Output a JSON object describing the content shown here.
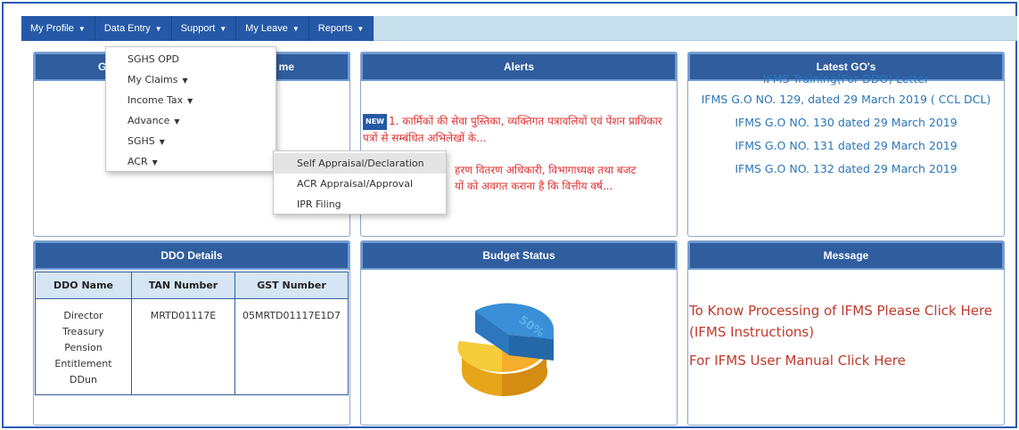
{
  "navbar": {
    "items": [
      {
        "label": "My Profile"
      },
      {
        "label": "Data Entry"
      },
      {
        "label": "Support"
      },
      {
        "label": "My Leave"
      },
      {
        "label": "Reports"
      }
    ]
  },
  "user_panel": {
    "head_left": "Gr",
    "head_right": "me"
  },
  "data_entry_menu": {
    "items": [
      {
        "label": "SGHS OPD"
      },
      {
        "label": "My Claims"
      },
      {
        "label": "Income Tax"
      },
      {
        "label": "Advance"
      },
      {
        "label": "SGHS"
      },
      {
        "label": "ACR"
      }
    ]
  },
  "acr_submenu": {
    "items": [
      {
        "label": "Self Appraisal/Declaration"
      },
      {
        "label": "ACR Appraisal/Approval"
      },
      {
        "label": "IPR Filing"
      }
    ]
  },
  "alerts": {
    "title": "Alerts",
    "badge": "NEW",
    "item1": "1. कार्मिकों की सेवा पुस्तिका, व्यक्तिगत पत्रावलियों एवं पेंशन प्राधिकार पत्रों से सम्बंधित अभिलेखों के...",
    "item2_line1": "हरण वितरण अधिकारी, विभागाध्यक्ष तथा बजट",
    "item2_line2": "यों को अवगत कराना है कि वित्तीय वर्ष..."
  },
  "latest_gos": {
    "title": "Latest GO's",
    "items": [
      {
        "label": "IFMS Training(For DDO) Letter"
      },
      {
        "label": "IFMS G.O NO. 129, dated 29 March 2019 ( CCL DCL)"
      },
      {
        "label": "IFMS G.O NO. 130 dated 29 March 2019"
      },
      {
        "label": "IFMS G.O NO. 131 dated 29 March 2019"
      },
      {
        "label": "IFMS G.O NO. 132 dated 29 March 2019"
      }
    ]
  },
  "ddo": {
    "title": "DDO Details",
    "headers": [
      "DDO Name",
      "TAN Number",
      "GST Number"
    ],
    "row": {
      "name": "Director Treasury Pension Entitlement DDun",
      "tan": "MRTD01117E",
      "gst": "05MRTD01117E1D7"
    }
  },
  "budget": {
    "title": "Budget Status",
    "pie_label": "50%",
    "colors": {
      "blue": "#2f7fc4",
      "yellow": "#f3c22c",
      "orange": "#f0a21e"
    }
  },
  "message": {
    "title": "Message",
    "link1": "To Know Processing of IFMS Please Click Here (IFMS Instructions)",
    "link2": "For IFMS User Manual Click Here"
  }
}
